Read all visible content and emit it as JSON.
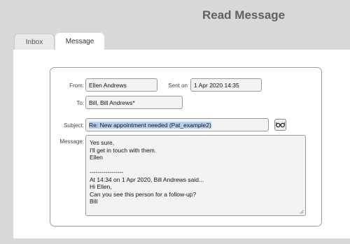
{
  "header": {
    "title": "Read Message"
  },
  "tabs": [
    {
      "label": "Inbox",
      "active": false
    },
    {
      "label": "Message",
      "active": true
    }
  ],
  "form": {
    "from_label": "From:",
    "from_value": "Ellen Andrews",
    "sent_label": "Sent on",
    "sent_value": "1 Apr 2020 14:35",
    "to_label": "To:",
    "to_value": "Bill, Bill Andrews*",
    "subject_label": "Subject:",
    "subject_value": "Re: New appointment needed (Pat_example2)",
    "message_label": "Message:",
    "message_lines": [
      "Yes sure,",
      "I'll get in touch with them.",
      "Ellen",
      "",
      "-----------------",
      "At 14:34 on 1 Apr 2020, Bill Andrews said...",
      "Hi Ellen,",
      "Can you see this person for a follow-up?",
      "Bill"
    ]
  },
  "icons": {
    "view_patient": "glasses-icon"
  }
}
